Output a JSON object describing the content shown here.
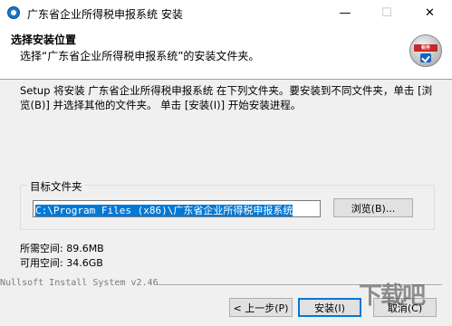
{
  "window": {
    "title": "广东省企业所得税申报系统 安装",
    "minimize_glyph": "—",
    "maximize_glyph": "☐",
    "close_glyph": "✕"
  },
  "header": {
    "title": "选择安装位置",
    "subtitle": "选择“广东省企业所得税申报系统”的安装文件夹。",
    "logo_text": "税务"
  },
  "body": {
    "description": "Setup 将安装 广东省企业所得税申报系统 在下列文件夹。要安装到不同文件夹，单击 [浏览(B)] 并选择其他的文件夹。 单击 [安装(I)] 开始安装进程。",
    "group_label": "目标文件夹",
    "path_value": "C:\\Program Files (x86)\\广东省企业所得税申报系统",
    "browse_label": "浏览(B)...",
    "space_required": "所需空间: 89.6MB",
    "space_available": "可用空间: 34.6GB"
  },
  "footer": {
    "branding": "Nullsoft Install System v2.46",
    "back_label": "< 上一步(P)",
    "install_label": "安装(I)",
    "cancel_label": "取消(C)"
  },
  "watermark": {
    "text": "下载吧"
  }
}
